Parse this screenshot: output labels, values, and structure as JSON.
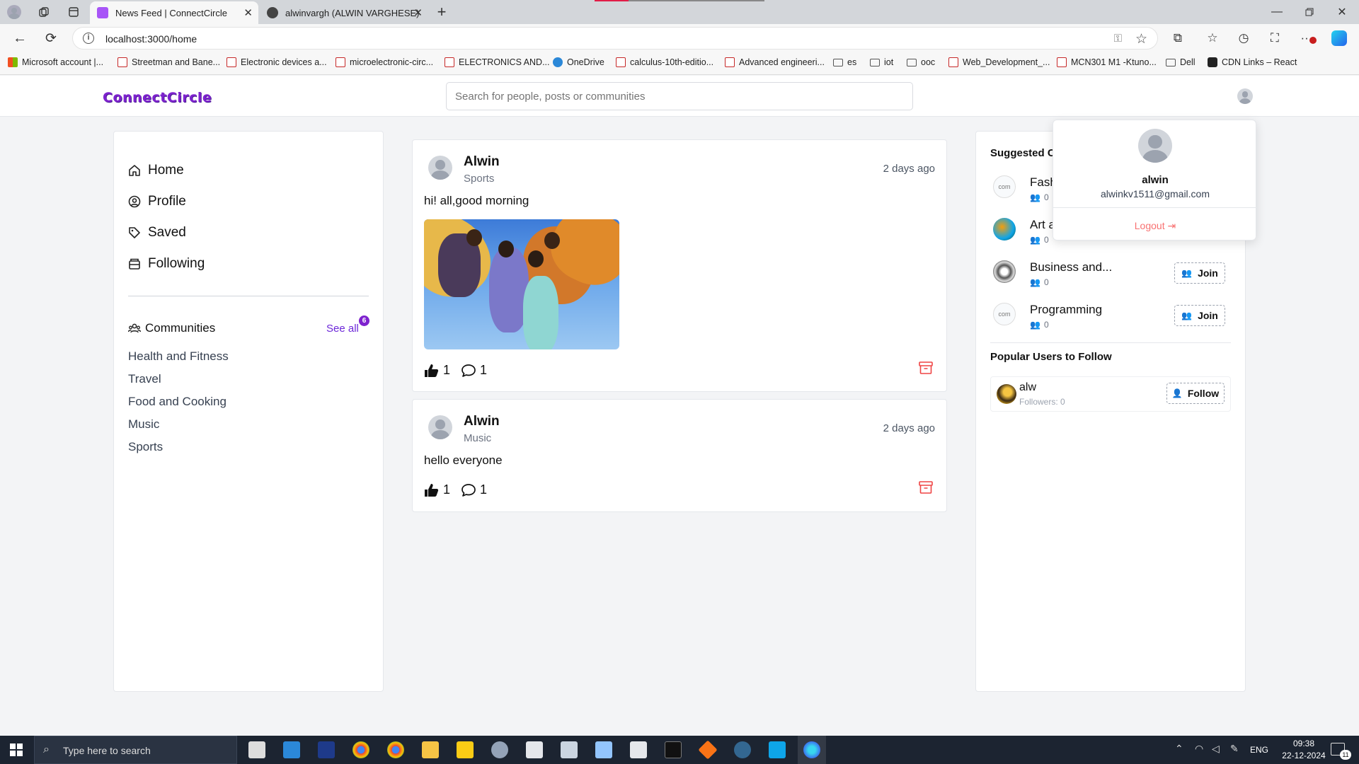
{
  "browser": {
    "tabs": [
      {
        "title": "News Feed | ConnectCircle",
        "active": true
      },
      {
        "title": "alwinvargh (ALWIN VARGHESE)",
        "active": false
      }
    ],
    "url": "localhost:3000/home",
    "bookmarks": [
      {
        "label": "Microsoft account |...",
        "icon": "windows-icon"
      },
      {
        "label": "Streetman and Bane...",
        "icon": "pdf-icon"
      },
      {
        "label": "Electronic devices a...",
        "icon": "pdf-icon"
      },
      {
        "label": "microelectronic-circ...",
        "icon": "pdf-icon"
      },
      {
        "label": "ELECTRONICS AND...",
        "icon": "pdf-icon"
      },
      {
        "label": "OneDrive",
        "icon": "cloud-icon"
      },
      {
        "label": "calculus-10th-editio...",
        "icon": "pdf-icon"
      },
      {
        "label": "Advanced engineeri...",
        "icon": "pdf-icon"
      },
      {
        "label": "es",
        "icon": "folder-icon"
      },
      {
        "label": "iot",
        "icon": "folder-icon"
      },
      {
        "label": "ooc",
        "icon": "folder-icon"
      },
      {
        "label": "Web_Development_...",
        "icon": "pdf-icon"
      },
      {
        "label": "MCN301 M1 -Ktuno...",
        "icon": "pdf-icon"
      },
      {
        "label": "Dell",
        "icon": "folder-icon"
      },
      {
        "label": "CDN Links – React",
        "icon": "react-icon"
      }
    ]
  },
  "app": {
    "logo": "ConnectCircle",
    "search_placeholder": "Search for people, posts or communities"
  },
  "sidebar": {
    "nav": [
      {
        "label": "Home",
        "icon": "home-icon"
      },
      {
        "label": "Profile",
        "icon": "user-circle-icon"
      },
      {
        "label": "Saved",
        "icon": "tag-icon"
      },
      {
        "label": "Following",
        "icon": "inbox-icon"
      }
    ],
    "communities_title": "Communities",
    "see_all": "See all",
    "badge": "6",
    "communities": [
      "Health and Fitness",
      "Travel",
      "Food and Cooking",
      "Music",
      "Sports"
    ]
  },
  "posts": [
    {
      "author": "Alwin",
      "community": "Sports",
      "time": "2 days ago",
      "text": "hi! all,good morning",
      "likes": "1",
      "comments": "1",
      "has_image": true
    },
    {
      "author": "Alwin",
      "community": "Music",
      "time": "2 days ago",
      "text": "hello everyone",
      "likes": "1",
      "comments": "1",
      "has_image": false
    }
  ],
  "right": {
    "suggested_title": "Suggested Co",
    "suggested": [
      {
        "name": "Fash",
        "members": "0"
      },
      {
        "name": "Art a",
        "members": "0"
      },
      {
        "name": "Business and...",
        "members": "0",
        "button": "Join"
      },
      {
        "name": "Programming",
        "members": "0",
        "button": "Join"
      }
    ],
    "popular_title": "Popular Users to Follow",
    "popular": [
      {
        "name": "alw",
        "followers": "Followers: 0",
        "button": "Follow"
      }
    ]
  },
  "dropdown": {
    "name": "alwin",
    "email": "alwinkv1511@gmail.com",
    "logout": "Logout"
  },
  "taskbar": {
    "search_placeholder": "Type here to search",
    "lang": "ENG",
    "time": "09:38",
    "date": "22-12-2024",
    "notif": "11"
  },
  "colors": {
    "accent": "#7e22ce",
    "logout": "#f87171",
    "archive": "#ef4444"
  }
}
